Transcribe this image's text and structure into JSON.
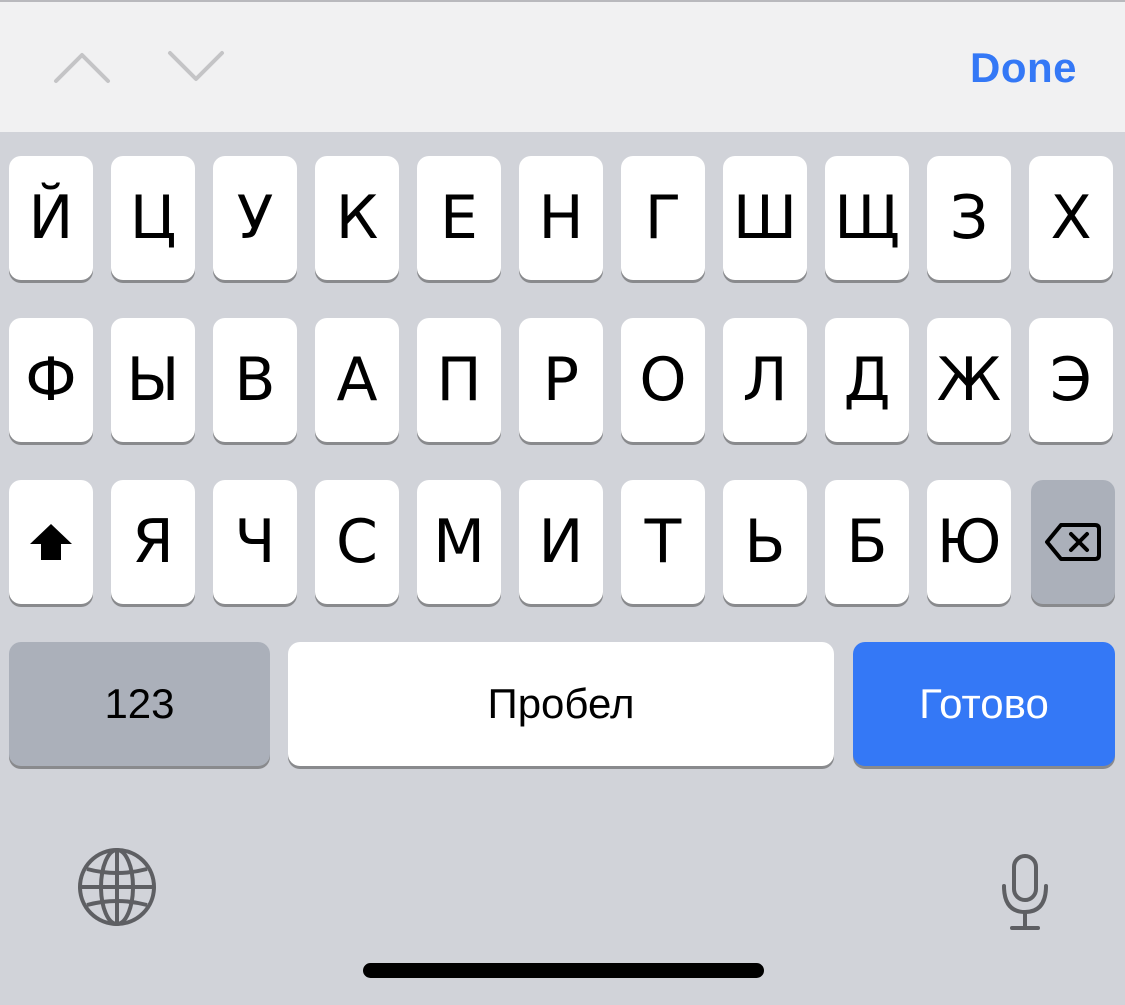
{
  "toolbar": {
    "done_label": "Done",
    "prev_icon": "chevron-up-icon",
    "next_icon": "chevron-down-icon",
    "accent_color": "#3478f6"
  },
  "keyboard": {
    "row1": [
      "Й",
      "Ц",
      "У",
      "К",
      "Е",
      "Н",
      "Г",
      "Ш",
      "Щ",
      "З",
      "Х"
    ],
    "row2": [
      "Ф",
      "Ы",
      "В",
      "А",
      "П",
      "Р",
      "О",
      "Л",
      "Д",
      "Ж",
      "Э"
    ],
    "row3": [
      "Я",
      "Ч",
      "С",
      "М",
      "И",
      "Т",
      "Ь",
      "Б",
      "Ю"
    ],
    "shift_icon": "shift-arrow-icon",
    "backspace_icon": "backspace-icon",
    "numbers_label": "123",
    "space_label": "Пробел",
    "return_label": "Готово",
    "return_color": "#3478f6",
    "globe_icon": "globe-icon",
    "mic_icon": "microphone-icon"
  }
}
